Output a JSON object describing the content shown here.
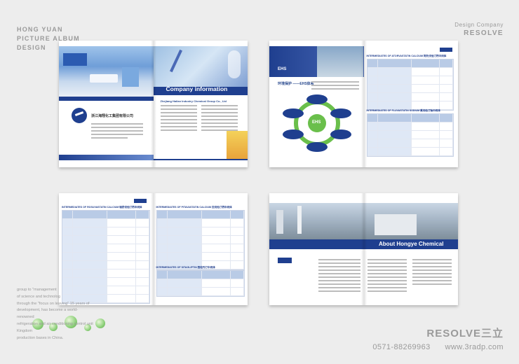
{
  "brand_left": {
    "line1": "HONG YUAN",
    "line2": "PICTURE ALBUM",
    "line3": "DESIGN"
  },
  "brand_right": {
    "line1": "Design Company",
    "line2": "RESOLVE"
  },
  "spread1": {
    "banner_title": "Company information",
    "company_cn": "浙江海翔化工集团有限公司",
    "company_en": "Zhejiang Hailan Industry Chemical Group Co., Ltd"
  },
  "spread2": {
    "ehs_label": "EHS",
    "ehs_cn": "环境保护 ——EHS体系",
    "ehs_center": "EHS",
    "table1_title": "INTERMEDIATES OF ATORVASTATIN CALCIUM 阿托伐他汀钙中间体",
    "table2_title": "INTERMEDIATES OF FLUVASTATIN SODIUM 氟伐他汀钠中间体"
  },
  "spread3": {
    "table1_title": "INTERMEDIATES OF ROSUVASTATIN CALCIUM 瑞舒伐他汀钙中间体",
    "table2_title": "INTERMEDIATES OF PITAVASTATIN CALCIUM 匹伐他汀钙中间体",
    "table3_title": "INTERMEDIATES OF SITAGLIPTIN 西他列汀中间体"
  },
  "spread4": {
    "banner_title": "About Hongye Chemical"
  },
  "footer_text": {
    "l1": "group to \"management",
    "l2": "of science and technolog",
    "l3": "through the \"focus on leaving\" 15 years of",
    "l4": "development, has become a world-renowned",
    "l5": "refrigeration and air conditioning control unit Kingdom",
    "l6": "production bases in China."
  },
  "bottom_right": {
    "logo": "RESOLVE三立",
    "phone": "0571-88269963",
    "site": "www.3radp.com"
  },
  "colors": {
    "accent_blue": "#1f3f8f",
    "mid_blue": "#4a69b6",
    "light_blue": "#b9cbe6",
    "green": "#6abf4b"
  }
}
